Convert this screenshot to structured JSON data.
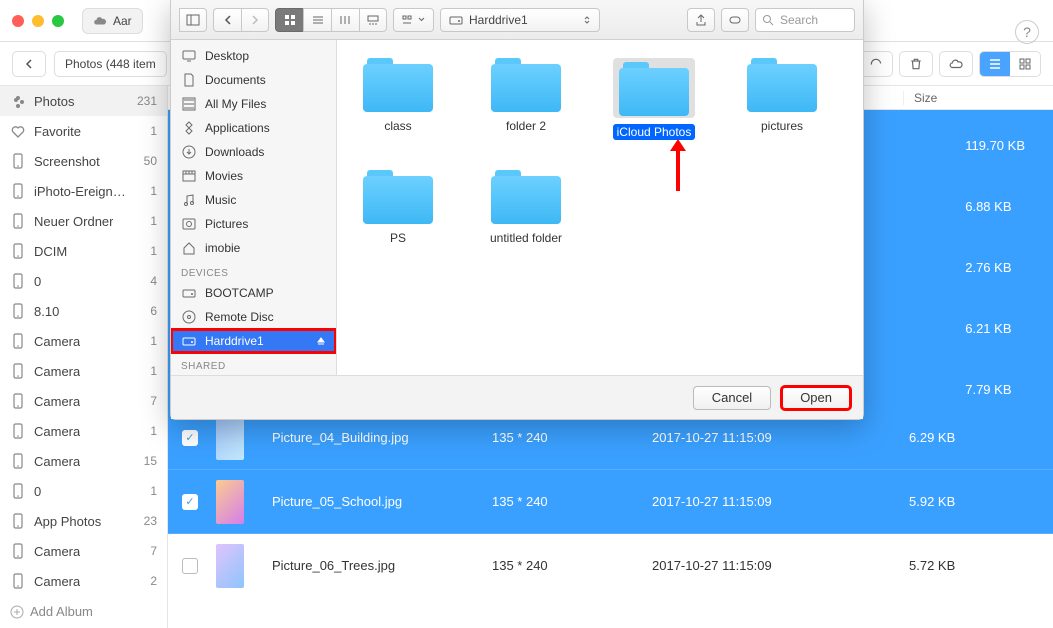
{
  "titlebar": {
    "account_label": "Aar"
  },
  "toolbar": {
    "crumb": "Photos (448 item"
  },
  "help_label": "?",
  "sidebar": [
    {
      "icon": "flower",
      "label": "Photos",
      "count": "231",
      "sel": true
    },
    {
      "icon": "heart",
      "label": "Favorite",
      "count": "1"
    },
    {
      "icon": "phone",
      "label": "Screenshot",
      "count": "50"
    },
    {
      "icon": "phone",
      "label": "iPhoto-Ereign…",
      "count": "1"
    },
    {
      "icon": "phone",
      "label": "Neuer Ordner",
      "count": "1"
    },
    {
      "icon": "phone",
      "label": "DCIM",
      "count": "1"
    },
    {
      "icon": "phone",
      "label": "0",
      "count": "4"
    },
    {
      "icon": "phone",
      "label": "8.10",
      "count": "6"
    },
    {
      "icon": "phone",
      "label": "Camera",
      "count": "1"
    },
    {
      "icon": "phone",
      "label": "Camera",
      "count": "1"
    },
    {
      "icon": "phone",
      "label": "Camera",
      "count": "7"
    },
    {
      "icon": "phone",
      "label": "Camera",
      "count": "1"
    },
    {
      "icon": "phone",
      "label": "Camera",
      "count": "15"
    },
    {
      "icon": "phone",
      "label": "0",
      "count": "1"
    },
    {
      "icon": "phone",
      "label": "App Photos",
      "count": "23"
    },
    {
      "icon": "phone",
      "label": "Camera",
      "count": "7"
    },
    {
      "icon": "phone",
      "label": "Camera",
      "count": "2"
    }
  ],
  "add_album": "Add Album",
  "columns": {
    "size": "Size"
  },
  "sizes_top": [
    "119.70 KB",
    "6.88 KB",
    "2.76 KB",
    "6.21 KB",
    "7.79 KB"
  ],
  "rows": [
    {
      "sel": true,
      "checked": true,
      "name": "Picture_04_Building.jpg",
      "dim": "135 * 240",
      "date": "2017-10-27 11:15:09",
      "size": "6.29 KB",
      "thumb": "b"
    },
    {
      "sel": true,
      "checked": true,
      "name": "Picture_05_School.jpg",
      "dim": "135 * 240",
      "date": "2017-10-27 11:15:09",
      "size": "5.92 KB",
      "thumb": "d"
    },
    {
      "sel": false,
      "checked": false,
      "name": "Picture_06_Trees.jpg",
      "dim": "135 * 240",
      "date": "2017-10-27 11:15:09",
      "size": "5.72 KB",
      "thumb": "e"
    }
  ],
  "finder": {
    "path_label": "Harddrive1",
    "search_placeholder": "Search",
    "favorites": [
      {
        "icon": "desktop",
        "label": "Desktop"
      },
      {
        "icon": "doc",
        "label": "Documents"
      },
      {
        "icon": "allfiles",
        "label": "All My Files"
      },
      {
        "icon": "apps",
        "label": "Applications"
      },
      {
        "icon": "downloads",
        "label": "Downloads"
      },
      {
        "icon": "movies",
        "label": "Movies"
      },
      {
        "icon": "music",
        "label": "Music"
      },
      {
        "icon": "pictures",
        "label": "Pictures"
      },
      {
        "icon": "home",
        "label": "imobie"
      }
    ],
    "devices_hdr": "Devices",
    "devices": [
      {
        "icon": "drive",
        "label": "BOOTCAMP"
      },
      {
        "icon": "disc",
        "label": "Remote Disc"
      },
      {
        "icon": "drive",
        "label": "Harddrive1",
        "sel": true,
        "hl": true
      }
    ],
    "shared_hdr": "Shared",
    "folders": [
      {
        "label": "class"
      },
      {
        "label": "folder 2"
      },
      {
        "label": "iCloud Photos",
        "sel": true
      },
      {
        "label": "pictures"
      },
      {
        "label": "PS"
      },
      {
        "label": "untitled folder"
      }
    ],
    "cancel": "Cancel",
    "open": "Open"
  }
}
